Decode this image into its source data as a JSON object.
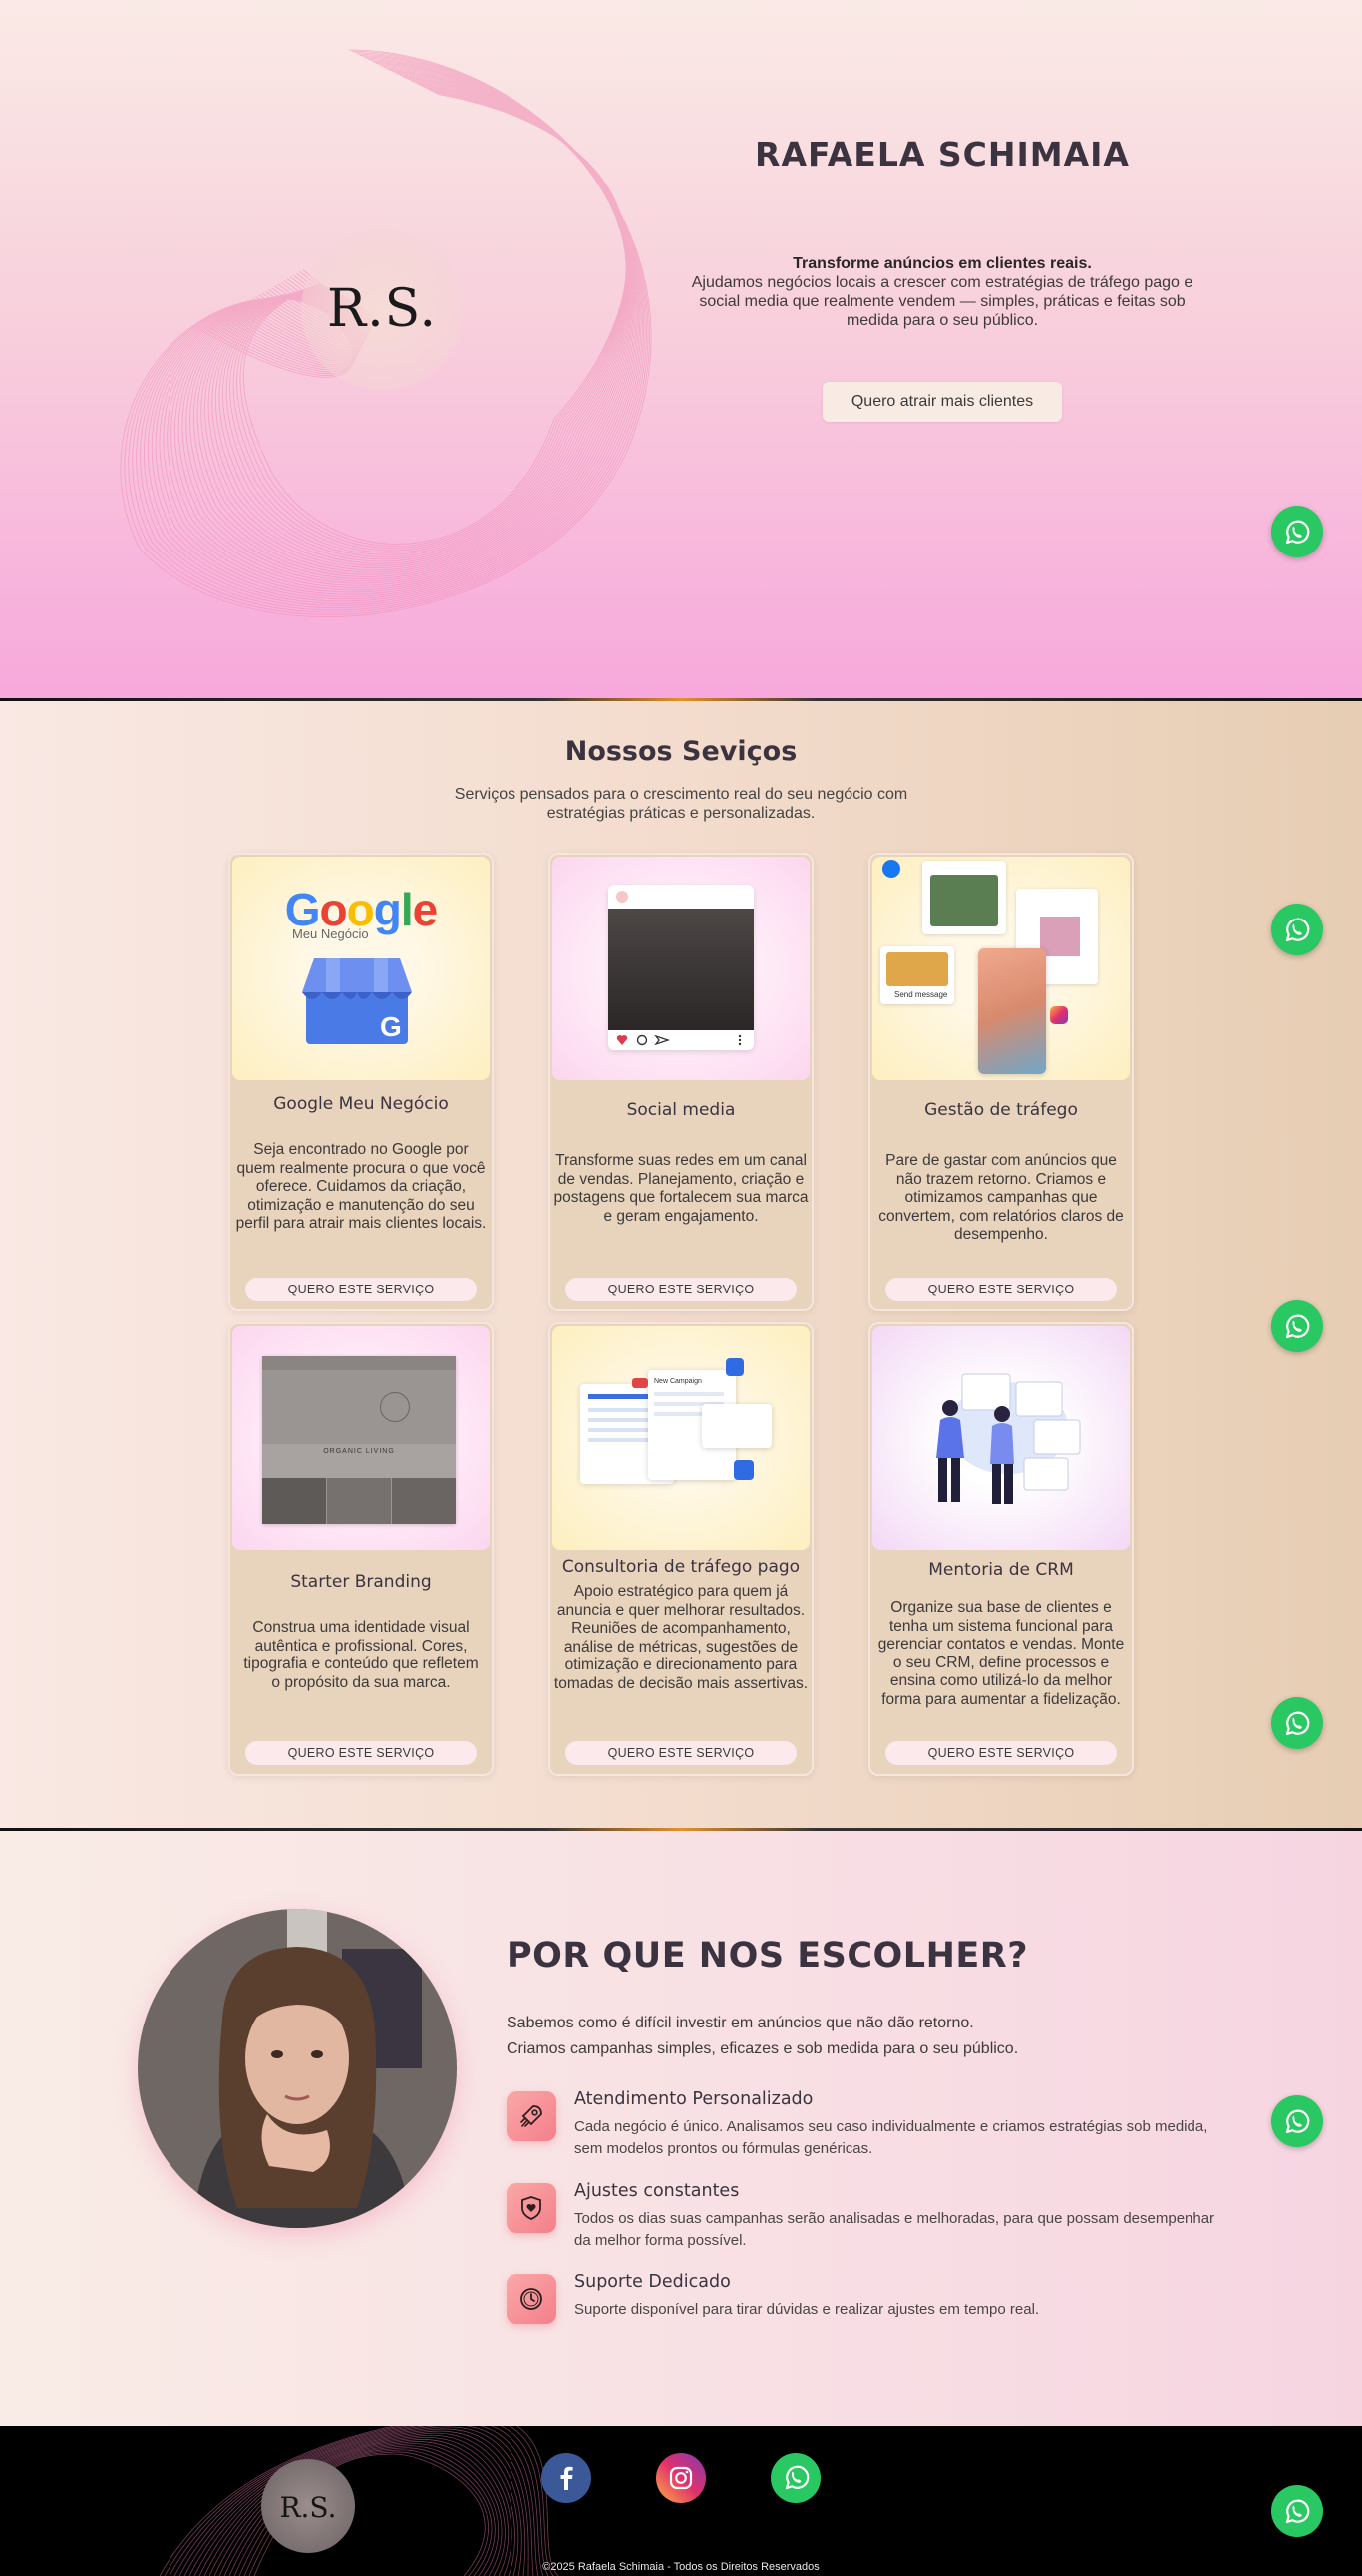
{
  "hero": {
    "logo": "R.S.",
    "title": "RAFAELA SCHIMAIA",
    "headline": "Transforme anúncios em clientes reais.",
    "description": "Ajudamos negócios locais a crescer com estratégias de tráfego pago e social media que realmente vendem — simples, práticas e feitas sob medida para o seu público.",
    "cta": "Quero atrair mais clientes"
  },
  "services": {
    "title": "Nossos Seviços",
    "subtitle": "Serviços pensados para o crescimento real do seu negócio com estratégias práticas e personalizadas.",
    "button_label": "QUERO ESTE SERVIÇO",
    "items": [
      {
        "title": "Google Meu Negócio",
        "text": "Seja encontrado no Google por quem realmente procura o que você oferece. Cuidamos da criação, otimização e manutenção do seu perfil para atrair mais clientes locais.",
        "image_text_1": "Google",
        "image_text_2": "Meu Negócio"
      },
      {
        "title": "Social media",
        "text": "Transforme suas redes em um canal de vendas. Planejamento, criação e postagens que fortalecem sua marca e geram engajamento."
      },
      {
        "title": "Gestão de tráfego",
        "text": "Pare de gastar com anúncios que não trazem retorno. Criamos e otimizamos campanhas que convertem, com relatórios claros de desempenho.",
        "image_text_1": "Send message"
      },
      {
        "title": "Starter Branding",
        "text": "Construa uma identidade visual autêntica e profissional. Cores, tipografia e conteúdo que refletem o propósito da sua marca.",
        "image_text_1": "ORGANIC LIVING"
      },
      {
        "title": "Consultoria de tráfego pago",
        "text": "Apoio estratégico para quem já anuncia e quer melhorar resultados. Reuniões de acompanhamento, análise de métricas, sugestões de otimização e direcionamento para tomadas de decisão mais assertivas.",
        "image_text_1": "New Campaign"
      },
      {
        "title": "Mentoria de CRM",
        "text": "Organize sua base de clientes e tenha um sistema funcional para gerenciar contatos e vendas. Monte o seu CRM, define processos e ensina como utilizá-lo da melhor forma para aumentar a fidelização."
      }
    ]
  },
  "why": {
    "title": "POR QUE NOS ESCOLHER?",
    "lead_1": "Sabemos como é difícil investir em anúncios que não dão retorno.",
    "lead_2": "Criamos campanhas simples, eficazes e sob medida para o seu público.",
    "features": [
      {
        "title": "Atendimento Personalizado",
        "text": "Cada negócio é único. Analisamos seu caso individualmente e criamos estratégias sob medida, sem modelos prontos ou fórmulas genéricas.",
        "icon": "rocket-icon"
      },
      {
        "title": "Ajustes constantes",
        "text": "Todos os dias suas campanhas serão analisadas e melhoradas, para que possam desempenhar da melhor forma possível.",
        "icon": "shield-heart-icon"
      },
      {
        "title": "Suporte Dedicado",
        "text": "Suporte disponível para tirar dúvidas e realizar ajustes em tempo real.",
        "icon": "clock-icon"
      }
    ]
  },
  "footer": {
    "logo": "R.S.",
    "copyright": "©2025 Rafaela Schimaia - Todos os Direitos Reservados",
    "social": [
      "facebook-icon",
      "instagram-icon",
      "whatsapp-icon"
    ]
  },
  "colors": {
    "accent": "#f47f8a",
    "whatsapp": "#29c862",
    "facebook": "#3b5998",
    "card_bg": "#e8d3bd"
  }
}
